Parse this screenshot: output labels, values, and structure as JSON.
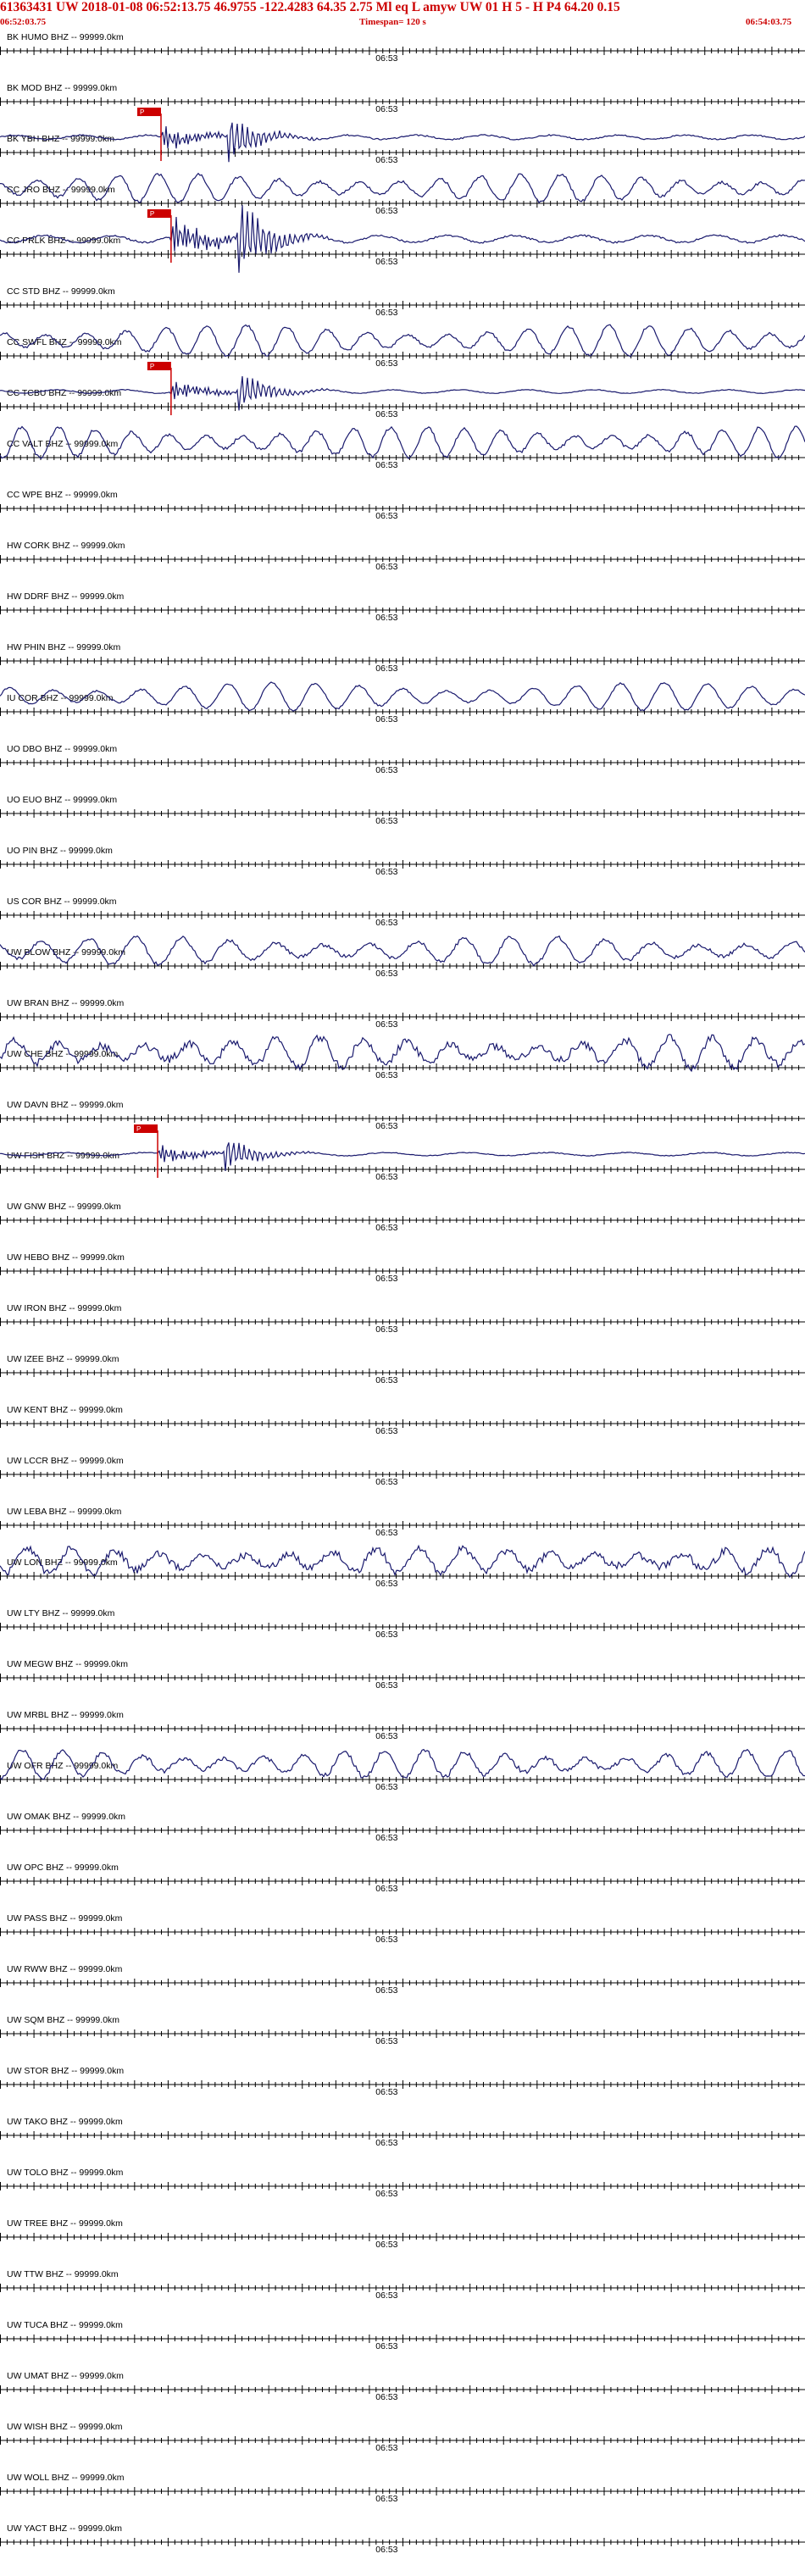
{
  "header": {
    "title": "61363431 UW 2018-01-08 06:52:13.75    46.9755 -122.4283  64.35   2.75 Ml  eq   L  amyw      UW 01   H    5   -    H P4     64.20   0.15",
    "start_time": "06:52:03.75",
    "timespan": "Timespan= 120 s",
    "end_time": "06:54:03.75"
  },
  "colors": {
    "trace": "#1a1a6e",
    "header": "#cc0000",
    "pick": "#cc0000",
    "axis": "#000000"
  },
  "chart_data": {
    "type": "line",
    "title": "61363431 UW 2018-01-08 06:52:13.75    46.9755 -122.4283  64.35   2.75 Ml  eq   L  amyw      UW 01   H    5   -    H P4     64.20   0.15",
    "x_range_s": [
      0,
      120
    ],
    "x_tick_label": "06:53",
    "x_tick_label_seconds": 57,
    "minor_tick_interval_s": 1,
    "major_tick_interval_s": 5,
    "pick_label": "P",
    "stations": [
      {
        "name": "BK HUMO BHZ -- 99999.0km",
        "waveform": "none"
      },
      {
        "name": "BK MOD BHZ -- 99999.0km",
        "waveform": "none"
      },
      {
        "name": "BK YBH BHZ -- 99999.0km",
        "waveform": "event",
        "pick_s": 24.0,
        "amp": 0.55,
        "period_s": 10,
        "noise": 0.05
      },
      {
        "name": "CC JRO BHZ -- 99999.0km",
        "waveform": "micro",
        "amp": 0.55,
        "period_s": 6,
        "noise": 0.05
      },
      {
        "name": "CC PRLK BHZ -- 99999.0km",
        "waveform": "event",
        "pick_s": 25.5,
        "amp": 0.9,
        "period_s": 10,
        "noise": 0.04
      },
      {
        "name": "CC STD BHZ -- 99999.0km",
        "waveform": "none"
      },
      {
        "name": "CC SWFL BHZ -- 99999.0km",
        "waveform": "micro",
        "amp": 0.6,
        "period_s": 6,
        "noise": 0.04
      },
      {
        "name": "CC TCBU BHZ -- 99999.0km",
        "waveform": "event",
        "pick_s": 25.5,
        "amp": 0.45,
        "period_s": 10,
        "noise": 0.03
      },
      {
        "name": "CC VALT BHZ -- 99999.0km",
        "waveform": "micro",
        "amp": 0.6,
        "period_s": 5.5,
        "noise": 0.05
      },
      {
        "name": "CC WPE BHZ -- 99999.0km",
        "waveform": "none"
      },
      {
        "name": "HW CORK BHZ -- 99999.0km",
        "waveform": "none"
      },
      {
        "name": "HW DDRF BHZ -- 99999.0km",
        "waveform": "none"
      },
      {
        "name": "HW PHIN BHZ -- 99999.0km",
        "waveform": "none"
      },
      {
        "name": "IU COR BHZ -- 99999.0km",
        "waveform": "micro",
        "amp": 0.55,
        "period_s": 6.5,
        "noise": 0.03
      },
      {
        "name": "UO DBO BHZ -- 99999.0km",
        "waveform": "none"
      },
      {
        "name": "UO EUO BHZ -- 99999.0km",
        "waveform": "none"
      },
      {
        "name": "UO PIN BHZ -- 99999.0km",
        "waveform": "none"
      },
      {
        "name": "US COR BHZ -- 99999.0km",
        "waveform": "none"
      },
      {
        "name": "UW BLOW BHZ -- 99999.0km",
        "waveform": "micro",
        "amp": 0.55,
        "period_s": 7,
        "noise": 0.06
      },
      {
        "name": "UW BRAN BHZ -- 99999.0km",
        "waveform": "none"
      },
      {
        "name": "UW CHE BHZ -- 99999.0km",
        "waveform": "micro",
        "amp": 0.6,
        "period_s": 6.5,
        "noise": 0.12
      },
      {
        "name": "UW DAVN BHZ -- 99999.0km",
        "waveform": "none"
      },
      {
        "name": "UW FISH BHZ -- 99999.0km",
        "waveform": "event",
        "pick_s": 23.5,
        "amp": 0.4,
        "period_s": 12,
        "noise": 0.04
      },
      {
        "name": "UW GNW BHZ -- 99999.0km",
        "waveform": "none"
      },
      {
        "name": "UW HEBO BHZ -- 99999.0km",
        "waveform": "none"
      },
      {
        "name": "UW IRON BHZ -- 99999.0km",
        "waveform": "none"
      },
      {
        "name": "UW IZEE BHZ -- 99999.0km",
        "waveform": "none"
      },
      {
        "name": "UW KENT BHZ -- 99999.0km",
        "waveform": "none"
      },
      {
        "name": "UW LCCR BHZ -- 99999.0km",
        "waveform": "none"
      },
      {
        "name": "UW LEBA BHZ -- 99999.0km",
        "waveform": "none"
      },
      {
        "name": "UW LON BHZ -- 99999.0km",
        "waveform": "micro",
        "amp": 0.5,
        "period_s": 6.5,
        "noise": 0.15
      },
      {
        "name": "UW LTY BHZ -- 99999.0km",
        "waveform": "none"
      },
      {
        "name": "UW MEGW BHZ -- 99999.0km",
        "waveform": "none"
      },
      {
        "name": "UW MRBL BHZ -- 99999.0km",
        "waveform": "none"
      },
      {
        "name": "UW OFR BHZ -- 99999.0km",
        "waveform": "micro",
        "amp": 0.55,
        "period_s": 6,
        "noise": 0.08
      },
      {
        "name": "UW OMAK BHZ -- 99999.0km",
        "waveform": "none"
      },
      {
        "name": "UW OPC BHZ -- 99999.0km",
        "waveform": "none"
      },
      {
        "name": "UW PASS BHZ -- 99999.0km",
        "waveform": "none"
      },
      {
        "name": "UW RWW BHZ -- 99999.0km",
        "waveform": "none"
      },
      {
        "name": "UW SQM BHZ -- 99999.0km",
        "waveform": "none"
      },
      {
        "name": "UW STOR BHZ -- 99999.0km",
        "waveform": "none"
      },
      {
        "name": "UW TAKO BHZ -- 99999.0km",
        "waveform": "none"
      },
      {
        "name": "UW TOLO BHZ -- 99999.0km",
        "waveform": "none"
      },
      {
        "name": "UW TREE BHZ -- 99999.0km",
        "waveform": "none"
      },
      {
        "name": "UW TTW BHZ -- 99999.0km",
        "waveform": "none"
      },
      {
        "name": "UW TUCA BHZ -- 99999.0km",
        "waveform": "none"
      },
      {
        "name": "UW UMAT BHZ -- 99999.0km",
        "waveform": "none"
      },
      {
        "name": "UW WISH BHZ -- 99999.0km",
        "waveform": "none"
      },
      {
        "name": "UW WOLL BHZ -- 99999.0km",
        "waveform": "none"
      },
      {
        "name": "UW YACT BHZ -- 99999.0km",
        "waveform": "none"
      }
    ]
  }
}
